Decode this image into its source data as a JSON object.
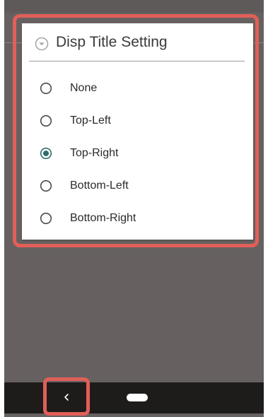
{
  "dialog": {
    "title": "Disp Title Setting",
    "icon": "chevron-down-circle-icon",
    "selected_index": 2,
    "options": [
      {
        "label": "None",
        "selected": false
      },
      {
        "label": "Top-Left",
        "selected": false
      },
      {
        "label": "Top-Right",
        "selected": true
      },
      {
        "label": "Bottom-Left",
        "selected": false
      },
      {
        "label": "Bottom-Right",
        "selected": false
      }
    ]
  },
  "navigation_bar": {
    "back_icon": "back-chevron-icon",
    "home_icon": "home-pill-icon"
  },
  "colors": {
    "highlight": "#e15f58",
    "radio_selected": "#2f6f6a",
    "radio_unselected": "#4a4a4a",
    "background_dim": "#666160",
    "navbar": "#1e1c1b"
  }
}
